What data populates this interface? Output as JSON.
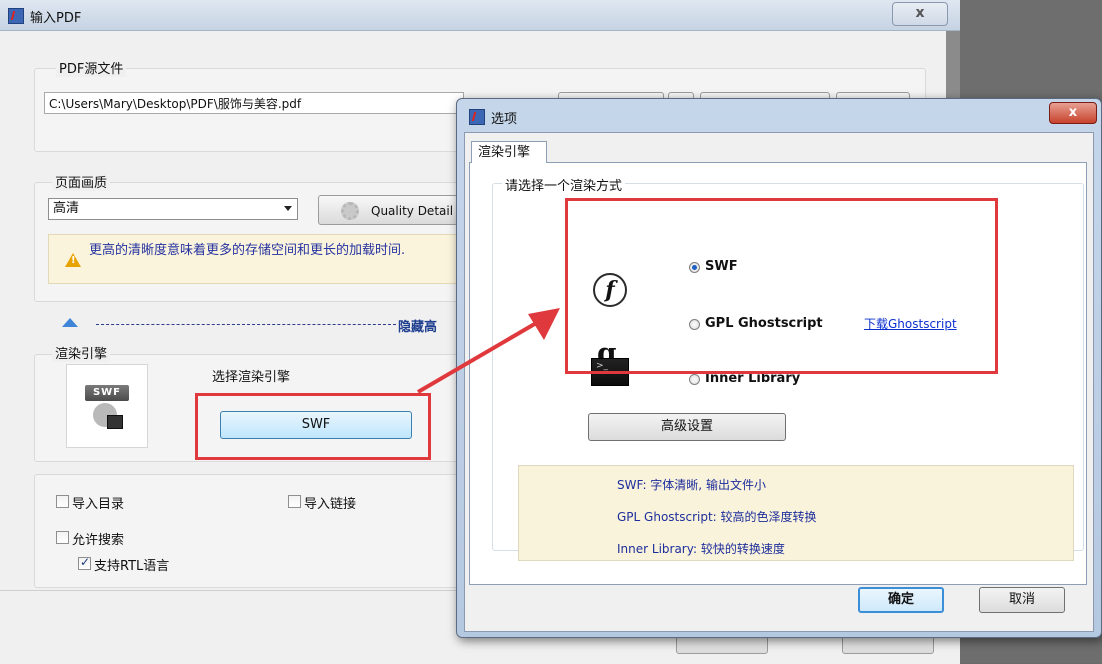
{
  "background_window": {
    "title": "输入PDF",
    "close_glyph": "x",
    "source_group": {
      "label": "PDF源文件",
      "path": "C:\\Users\\Mary\\Desktop\\PDF\\服饰与美容.pdf"
    },
    "quality_group": {
      "label": "页面画质",
      "selected": "高清",
      "quality_detail_button": "Quality Detail",
      "warning_text": "更高的清晰度意味着更多的存储空间和更长的加载时间."
    },
    "collapse_label": "隐藏高",
    "engine_group": {
      "label": "渲染引擎",
      "thumb_badge": "SWF",
      "select_label": "选择渲染引擎",
      "engine_button": "SWF"
    },
    "options": {
      "import_toc": "导入目录",
      "import_links": "导入链接",
      "allow_search": "允许搜索",
      "rtl_support": "支持RTL语言",
      "import_toc_checked": false,
      "import_links_checked": false,
      "allow_search_checked": false,
      "rtl_support_checked": true
    }
  },
  "dialog": {
    "title": "选项",
    "close_glyph": "x",
    "tab": "渲染引擎",
    "group_label": "请选择一个渲染方式",
    "engines": [
      {
        "icon": "flash-icon",
        "label": "SWF",
        "selected": true
      },
      {
        "icon": "ghostscript-icon",
        "label": "GPL Ghostscript",
        "selected": false,
        "link": "下载Ghostscript"
      },
      {
        "icon": "terminal-icon",
        "label": "Inner Library",
        "selected": false
      }
    ],
    "advanced_button": "高级设置",
    "info_lines": [
      "SWF: 字体清晰, 输出文件小",
      "GPL Ghostscript: 较高的色泽度转换",
      "Inner Library: 较快的转换速度"
    ],
    "ok_button": "确定",
    "cancel_button": "取消"
  },
  "colors": {
    "highlight": "#e0393d",
    "link": "#0b2fd1",
    "info_text": "#1d2d9b"
  }
}
